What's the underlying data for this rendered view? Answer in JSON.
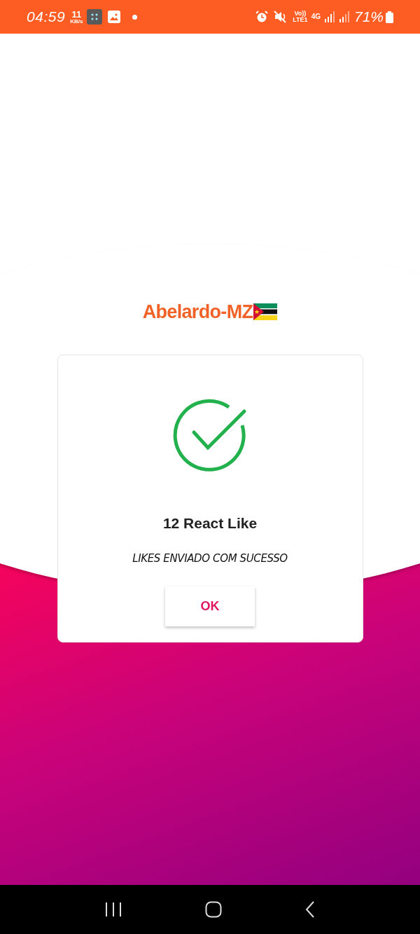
{
  "status_bar": {
    "time": "04:59",
    "speed_value": "11",
    "speed_unit": "KB/s",
    "volte": "Vo))",
    "lte": "LTE1",
    "network": "4G",
    "battery": "71%"
  },
  "title": "Abelardo-MZ",
  "dialog": {
    "heading": "12 React Like",
    "message": "LIKES ENVIADO COM SUCESSO",
    "button": "OK"
  }
}
